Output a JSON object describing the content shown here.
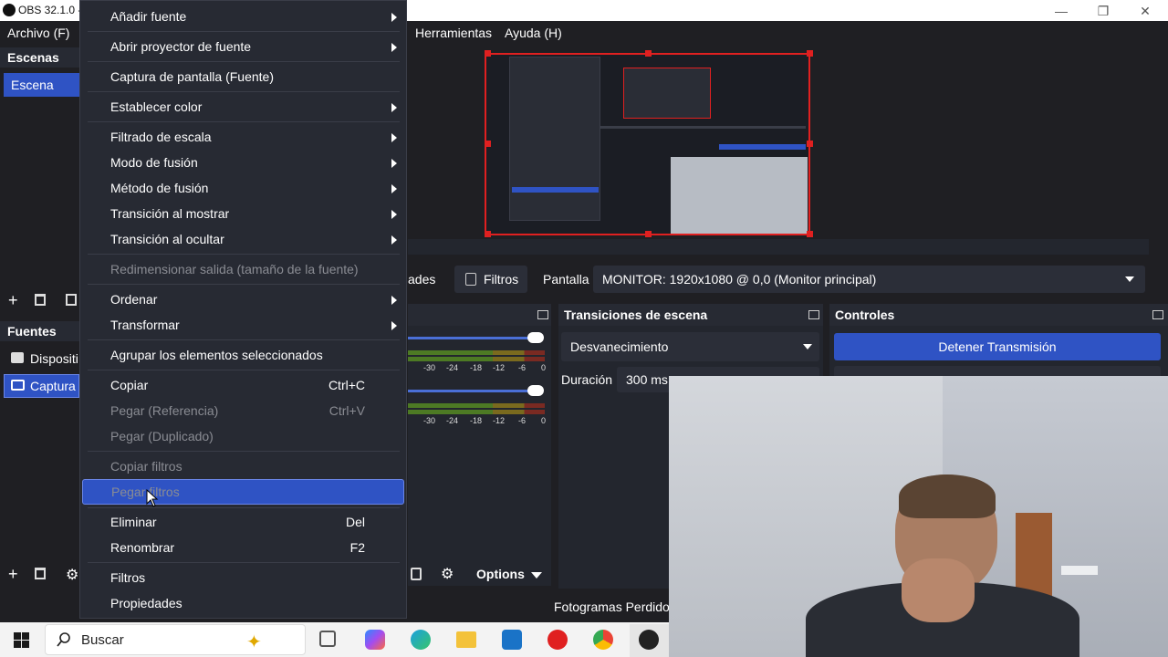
{
  "window": {
    "title": "OBS 32.1.0 -",
    "controls": [
      "minimize-icon",
      "restore-icon",
      "close-icon"
    ]
  },
  "menubar": {
    "archivo": "Archivo (F)",
    "herramientas": "Herramientas",
    "ayuda": "Ayuda (H)"
  },
  "scenes": {
    "title": "Escenas",
    "items": [
      "Escena"
    ]
  },
  "sources": {
    "title": "Fuentes",
    "items": [
      "Dispositi",
      "Captura"
    ]
  },
  "source_toolbar": {
    "props_partial": "ades",
    "filters": "Filtros",
    "pantalla_label": "Pantalla",
    "monitor_value": "MONITOR: 1920x1080 @ 0,0 (Monitor principal)"
  },
  "mixer": {
    "ticks": [
      "-30",
      "-24",
      "-18",
      "-12",
      "-6",
      "0"
    ],
    "options": "Options"
  },
  "transitions": {
    "title": "Transiciones de escena",
    "selected": "Desvanecimiento",
    "duration_label": "Duración",
    "duration_value": "300 ms"
  },
  "controls": {
    "title": "Controles",
    "stop_stream": "Detener Transmisión"
  },
  "statusbar": {
    "dropped_frames": "Fotogramas Perdidos"
  },
  "context_menu": {
    "items": [
      {
        "label": "Añadir fuente",
        "submenu": true
      },
      {
        "label": "Abrir proyector de fuente",
        "submenu": true
      },
      {
        "label": "Captura de pantalla (Fuente)"
      },
      {
        "label": "Establecer color",
        "submenu": true
      },
      {
        "label": "Filtrado de escala",
        "submenu": true
      },
      {
        "label": "Modo de fusión",
        "submenu": true
      },
      {
        "label": "Método de fusión",
        "submenu": true
      },
      {
        "label": "Transición al mostrar",
        "submenu": true
      },
      {
        "label": "Transición al ocultar",
        "submenu": true
      },
      {
        "label": "Redimensionar salida (tamaño de la fuente)",
        "disabled": true
      },
      {
        "label": "Ordenar",
        "submenu": true
      },
      {
        "label": "Transformar",
        "submenu": true
      },
      {
        "label": "Agrupar los elementos seleccionados"
      },
      {
        "label": "Copiar",
        "shortcut": "Ctrl+C"
      },
      {
        "label": "Pegar (Referencia)",
        "shortcut": "Ctrl+V",
        "disabled": true
      },
      {
        "label": "Pegar (Duplicado)",
        "disabled": true
      },
      {
        "label": "Copiar filtros",
        "disabled": true
      },
      {
        "label": "Pegar filtros",
        "disabled": true,
        "highlighted": true
      },
      {
        "label": "Eliminar",
        "shortcut": "Del"
      },
      {
        "label": "Renombrar",
        "shortcut": "F2"
      },
      {
        "label": "Filtros"
      },
      {
        "label": "Propiedades"
      }
    ]
  },
  "taskbar": {
    "search_placeholder": "Buscar"
  },
  "colors": {
    "accent": "#2f53c4",
    "selection_border": "#e02020",
    "bg": "#1f1f23",
    "panel": "#272a33"
  }
}
